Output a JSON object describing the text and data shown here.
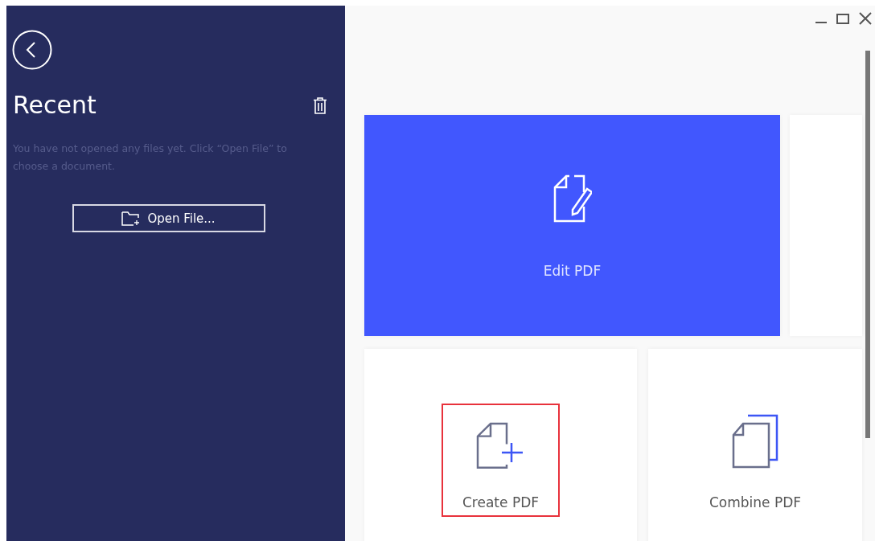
{
  "sidebar": {
    "title": "Recent",
    "hint": "You have not opened any files yet. Click “Open File” to choose a document.",
    "open_button": "Open File..."
  },
  "tiles": [
    {
      "label": "Edit PDF",
      "kind": "edit",
      "selected": true,
      "highlighted": false
    },
    {
      "label": "Create PDF",
      "kind": "create",
      "selected": false,
      "highlighted": true
    },
    {
      "label": "Combine PDF",
      "kind": "combine",
      "selected": false,
      "highlighted": false
    }
  ]
}
